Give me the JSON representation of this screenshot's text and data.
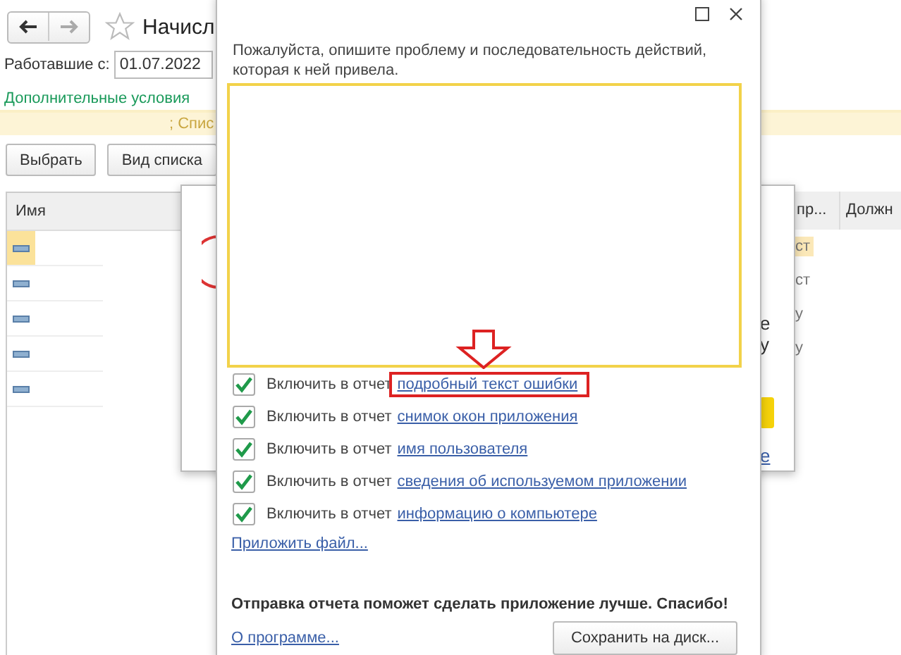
{
  "main_window": {
    "title": "Начисл",
    "filter_label": "Работавшие с:",
    "filter_date": "01.07.2022",
    "conditions_link": "Дополнительные условия",
    "conditions_text": "; Спис",
    "buttons": [
      "Выбрать",
      "Вид списка"
    ],
    "table": {
      "columns": [
        "Имя"
      ],
      "rows": [
        {
          "selected": true
        },
        {
          "selected": false
        },
        {
          "selected": false
        },
        {
          "selected": false
        },
        {
          "selected": false
        }
      ]
    },
    "right_columns": [
      "пр...",
      "Должн"
    ],
    "right_rows": [
      {
        "text": "ст",
        "selected": true
      },
      {
        "text": "ст",
        "selected": false
      },
      {
        "text": "у",
        "selected": false
      },
      {
        "text": "у",
        "selected": false
      }
    ]
  },
  "middle_dialog": {
    "fragments": [
      "е",
      "у"
    ],
    "link": "е"
  },
  "report_dialog": {
    "prompt": "Пожалуйста, опишите проблему и последовательность действий, которая к ней привела.",
    "options": [
      {
        "label": "Включить в отчет",
        "link": "подробный текст ошибки",
        "checked": true,
        "highlighted": true
      },
      {
        "label": "Включить в отчет",
        "link": "снимок окон приложения",
        "checked": true,
        "highlighted": false
      },
      {
        "label": "Включить в отчет",
        "link": "имя пользователя",
        "checked": true,
        "highlighted": false
      },
      {
        "label": "Включить в отчет",
        "link": "сведения об используемом приложении",
        "checked": true,
        "highlighted": false
      },
      {
        "label": "Включить в отчет",
        "link": "информацию о компьютере",
        "checked": true,
        "highlighted": false
      }
    ],
    "attach_link": "Приложить файл...",
    "thanks": "Отправка отчета поможет сделать приложение лучше. Спасибо!",
    "about_link": "О программе...",
    "save_button": "Сохранить на диск..."
  }
}
